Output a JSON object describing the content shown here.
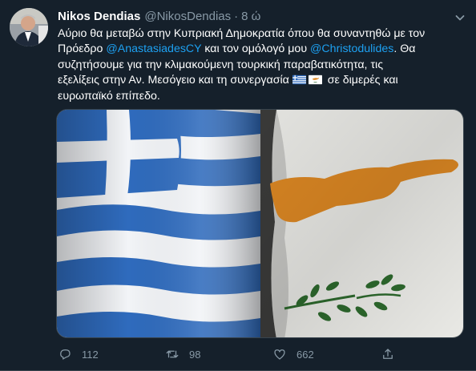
{
  "tweet": {
    "author_name": "Nikos Dendias",
    "author_handle": "@NikosDendias",
    "separator": "·",
    "time": "8 ώ",
    "text": {
      "line1": "Αύριο θα μεταβώ στην Κυπριακή Δημοκρατία όπου θα συναντηθώ με τον",
      "line2_a": "Πρόεδρο ",
      "mention1": "@AnastasiadesCY",
      "line2_b": " και τον ομόλογό μου ",
      "mention2": "@Christodulides",
      "line2_c": ". Θα",
      "line3": "συζητήσουμε για την κλιμακούμενη τουρκική παραβατικότητα, τις",
      "line4_a": "εξελίξεις στην Αν. Μεσόγειο και τη συνεργασία ",
      "line4_b": " σε διμερές και",
      "line5": "ευρωπαϊκό επίπεδο."
    },
    "emoji_flags": [
      "greece-flag-emoji",
      "cyprus-flag-emoji"
    ],
    "actions": {
      "replies": "112",
      "retweets": "98",
      "likes": "662"
    }
  },
  "colors": {
    "background": "#15202b",
    "accent": "#1da1f2",
    "muted": "#8899a6",
    "border": "#38444d",
    "greek_blue": "#2f6bbd",
    "cyprus_copper": "#e08a24",
    "olive_green": "#2e6b2e"
  }
}
